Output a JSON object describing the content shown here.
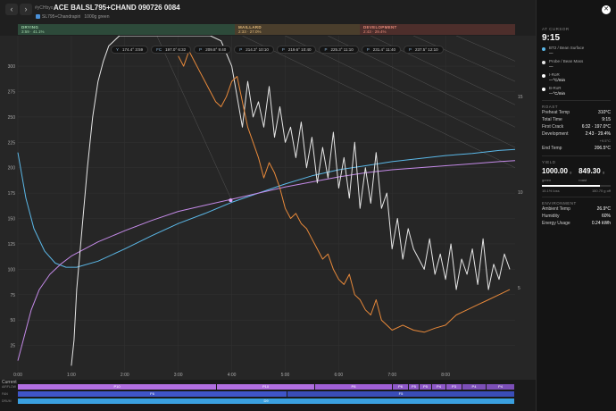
{
  "header": {
    "back_icon": "‹",
    "forward_icon": "›",
    "owner": "#yCHbyo",
    "title": "ACE BALSL795+CHAND 090726 0084",
    "machine": "SL795+Chandrapiri",
    "batch": "1000g green"
  },
  "phases": {
    "drying": {
      "name": "DRYING",
      "detail": "3:59 · 41.1%"
    },
    "maillard": {
      "name": "MAILLARD",
      "detail": "2:33 · 27.0%"
    },
    "development": {
      "name": "DEVELOPMENT",
      "detail": "2:43 · 29.4%"
    }
  },
  "pills": [
    {
      "k": "Y",
      "v": "174.4° 3:59"
    },
    {
      "k": "FC",
      "v": "197.0° 6:32"
    },
    {
      "k": "P",
      "v": "209.8° 9:40"
    },
    {
      "k": "P",
      "v": "214.3° 10:10"
    },
    {
      "k": "P",
      "v": "219.6° 10:40"
    },
    {
      "k": "P",
      "v": "225.3° 11:10"
    },
    {
      "k": "P",
      "v": "231.4° 11:40"
    },
    {
      "k": "P",
      "v": "237.5° 12:10"
    }
  ],
  "chart_data": {
    "type": "line",
    "xlim": [
      0,
      9.3
    ],
    "ylim": [
      0,
      330
    ],
    "y_ticks": [
      25,
      50,
      75,
      100,
      125,
      150,
      175,
      200,
      225,
      250,
      275,
      300
    ],
    "x_ticks": [
      "0:00",
      "1:00",
      "2:00",
      "3:00",
      "4:00",
      "5:00",
      "6:00",
      "7:00",
      "8:00"
    ],
    "right_ticks": [
      {
        "label": "15",
        "y": 270
      },
      {
        "label": "10",
        "y": 176
      },
      {
        "label": "5",
        "y": 82
      }
    ],
    "series": [
      {
        "color": "#5bb8e8",
        "x": [
          0,
          0.15,
          0.3,
          0.5,
          0.7,
          0.9,
          1.1,
          1.5,
          2,
          2.5,
          3,
          3.5,
          4,
          4.5,
          5,
          5.5,
          6,
          6.5,
          7,
          7.5,
          8,
          8.5,
          9,
          9.3
        ],
        "y": [
          215,
          170,
          140,
          118,
          106,
          102,
          102,
          108,
          120,
          133,
          145,
          155,
          166,
          175,
          184,
          192,
          198,
          202,
          206,
          209,
          212,
          214,
          217,
          218
        ]
      },
      {
        "color": "#c48ae8",
        "x": [
          0,
          0.1,
          0.25,
          0.4,
          0.6,
          0.8,
          1.0,
          1.5,
          2,
          2.5,
          3,
          3.5,
          4,
          4.5,
          5,
          5.5,
          6,
          6.5,
          7,
          7.5,
          8,
          8.5,
          9,
          9.3
        ],
        "y": [
          10,
          30,
          60,
          80,
          95,
          105,
          113,
          127,
          138,
          148,
          157,
          163,
          169,
          175,
          181,
          186,
          191,
          195,
          198,
          200,
          202,
          204,
          206,
          207
        ]
      },
      {
        "color": "#e6e6e6",
        "x": [
          1.0,
          1.05,
          1.1,
          1.2,
          1.3,
          1.4,
          1.5,
          1.6,
          1.7,
          1.8,
          1.9,
          2.0,
          2.3,
          2.6,
          3.0,
          3.2,
          3.4,
          3.6,
          3.8,
          4.0,
          4.1,
          4.2,
          4.3,
          4.4,
          4.5,
          4.6,
          4.7,
          4.8,
          4.9,
          5.0,
          5.1,
          5.2,
          5.3,
          5.4,
          5.5,
          5.6,
          5.7,
          5.8,
          5.9,
          6.0,
          6.1,
          6.2,
          6.3,
          6.4,
          6.5,
          6.6,
          6.7,
          6.8,
          6.9,
          7.0,
          7.1,
          7.2,
          7.3,
          7.4,
          7.5,
          7.6,
          7.7,
          7.8,
          7.9,
          8.0,
          8.1,
          8.2,
          8.3,
          8.4,
          8.5,
          8.6,
          8.7,
          8.8,
          8.9,
          9.0,
          9.1,
          9.2
        ],
        "y": [
          5,
          30,
          80,
          140,
          200,
          250,
          285,
          305,
          320,
          325,
          330,
          330,
          330,
          330,
          330,
          330,
          330,
          330,
          325,
          300,
          270,
          240,
          285,
          250,
          265,
          240,
          280,
          230,
          260,
          225,
          240,
          210,
          245,
          200,
          230,
          185,
          220,
          190,
          235,
          180,
          210,
          170,
          225,
          160,
          200,
          165,
          215,
          160,
          175,
          120,
          150,
          110,
          140,
          120,
          110,
          100,
          130,
          95,
          115,
          90,
          125,
          80,
          110,
          95,
          120,
          85,
          130,
          80,
          105,
          90,
          115,
          100
        ]
      },
      {
        "color": "#e8893a",
        "x": [
          3.0,
          3.1,
          3.2,
          3.3,
          3.4,
          3.5,
          3.6,
          3.7,
          3.8,
          3.9,
          4.0,
          4.1,
          4.2,
          4.3,
          4.4,
          4.5,
          4.6,
          4.7,
          4.8,
          4.9,
          5.0,
          5.1,
          5.2,
          5.3,
          5.4,
          5.5,
          5.6,
          5.7,
          5.8,
          5.9,
          6.0,
          6.1,
          6.2,
          6.3,
          6.4,
          6.5,
          6.6,
          6.7,
          6.8,
          6.9,
          7.0,
          7.2,
          7.4,
          7.6,
          7.8,
          8.0,
          8.2,
          8.4,
          8.6,
          8.8,
          9.0,
          9.2
        ],
        "y": [
          310,
          300,
          315,
          305,
          295,
          285,
          275,
          265,
          260,
          270,
          285,
          290,
          265,
          240,
          225,
          210,
          190,
          205,
          195,
          180,
          160,
          150,
          155,
          145,
          140,
          130,
          120,
          110,
          115,
          100,
          90,
          85,
          95,
          75,
          70,
          60,
          55,
          70,
          50,
          45,
          40,
          45,
          40,
          38,
          42,
          45,
          55,
          60,
          65,
          70,
          75,
          80
        ]
      }
    ],
    "marker": {
      "x": 3.98,
      "y": 168
    }
  },
  "events": {
    "current_label": "Current",
    "rows": [
      {
        "label": "AIRFLOW",
        "bars": [
          {
            "text": "P10",
            "color": "#b06ee0"
          },
          {
            "text": "P10",
            "color": "#b06ee0"
          },
          {
            "text": "P8",
            "color": "#9f5fd6"
          },
          {
            "text": "P6",
            "color": "#8e58c8"
          },
          {
            "text": "P5",
            "color": "#8e58c8"
          },
          {
            "text": "P5",
            "color": "#8e58c8"
          },
          {
            "text": "P4",
            "color": "#8e58c8"
          },
          {
            "text": "P3",
            "color": "#8e58c8"
          },
          {
            "text": "P4",
            "color": "#7c4fb8"
          },
          {
            "text": "P4",
            "color": "#7c4fb8"
          }
        ]
      },
      {
        "label": "FAN",
        "bars": [
          {
            "text": "F6",
            "color": "#3f55c8"
          },
          {
            "text": "F5",
            "color": "#3a4db8"
          }
        ]
      },
      {
        "label": "DRUM",
        "bars": [
          {
            "text": "D9",
            "color": "#3aa0e0"
          }
        ]
      }
    ]
  },
  "panel": {
    "close_icon": "✕",
    "cursor_label": "AT CURSOR",
    "cursor_time": "9:15",
    "cursor_items": [
      {
        "name": "BT2 / Bean Surface",
        "value": "—",
        "color": "#5bb8e8"
      },
      {
        "name": "Probe / Bean Mass",
        "value": "—",
        "color": "#e6e6e6"
      },
      {
        "name": "I-RoR",
        "value": "—°C/min",
        "color": "#ffffff"
      },
      {
        "name": "B-RoR",
        "value": "—°C/min",
        "color": "#ffffff"
      }
    ],
    "roast_label": "ROAST",
    "roast_rows": [
      {
        "k": "Preheat Temp",
        "v": "310°C"
      },
      {
        "k": "Total Time",
        "v": "9:15"
      },
      {
        "k": "First Crack",
        "v": "6:32 · 197.0°C"
      },
      {
        "k": "Development",
        "v": "2:43 · 29.4%"
      },
      {
        "k": "",
        "v": "+9.5°C"
      },
      {
        "k": "End Temp",
        "v": "206.5°C"
      }
    ],
    "yield_label": "YIELD",
    "yield_green": "1000.00",
    "yield_green_unit": "g green",
    "yield_roast": "849.30",
    "yield_roast_unit": "g roast",
    "yield_loss": "15.1% loss",
    "yield_off": "150.70 g off",
    "env_label": "ENVIRONMENT",
    "env_rows": [
      {
        "k": "Ambient Temp",
        "v": "26.9°C"
      },
      {
        "k": "Humidity",
        "v": "60%"
      },
      {
        "k": "Energy Usage",
        "v": "0.24 kWh"
      }
    ]
  }
}
